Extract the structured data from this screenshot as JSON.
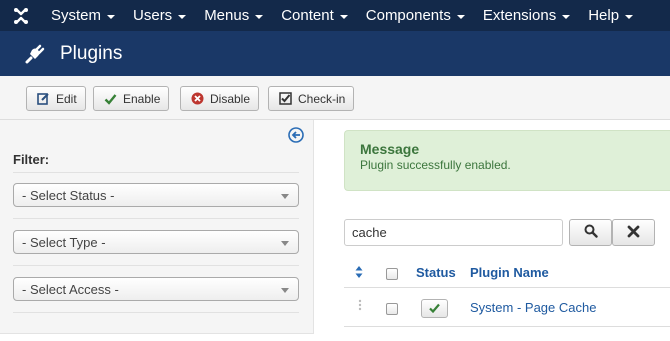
{
  "topnav": {
    "items": [
      {
        "label": "System"
      },
      {
        "label": "Users"
      },
      {
        "label": "Menus"
      },
      {
        "label": "Content"
      },
      {
        "label": "Components"
      },
      {
        "label": "Extensions"
      },
      {
        "label": "Help"
      }
    ]
  },
  "header": {
    "title": "Plugins",
    "icon": "plug-icon"
  },
  "toolbar": {
    "edit_label": "Edit",
    "enable_label": "Enable",
    "disable_label": "Disable",
    "checkin_label": "Check-in"
  },
  "sidebar": {
    "filter_label": "Filter:",
    "status_select": "- Select Status -",
    "type_select": "- Select Type -",
    "access_select": "- Select Access -"
  },
  "message": {
    "title": "Message",
    "text": "Plugin successfully enabled."
  },
  "search": {
    "value": "cache"
  },
  "table": {
    "columns": {
      "status": "Status",
      "name": "Plugin Name"
    },
    "rows": [
      {
        "name": "System - Page Cache",
        "enabled": true
      }
    ]
  },
  "colors": {
    "nav_bg": "#13294a",
    "header_bg": "#1a3867",
    "success_bg": "#dff0d8",
    "success_text": "#3c763d",
    "link": "#1f5aa0"
  }
}
